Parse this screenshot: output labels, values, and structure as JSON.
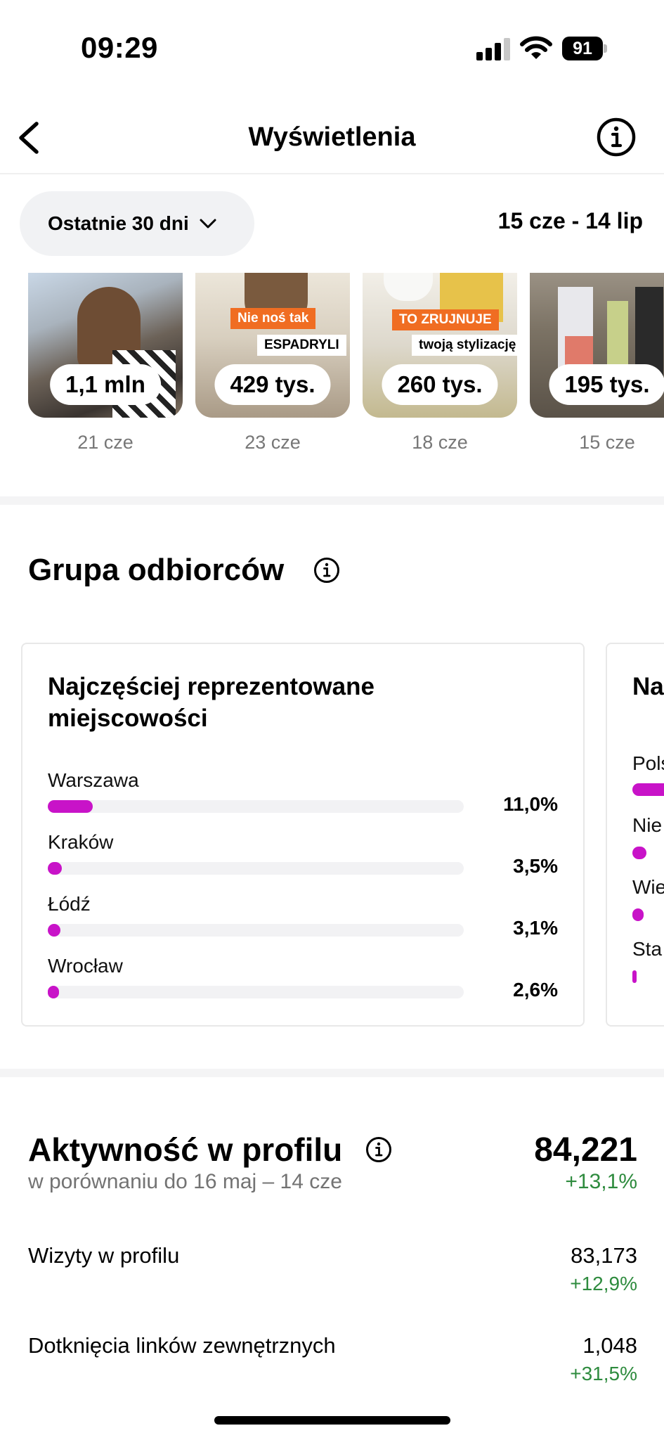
{
  "status_bar": {
    "time": "09:29",
    "battery": "91"
  },
  "header": {
    "title": "Wyświetlenia"
  },
  "filter": {
    "period_label": "Ostatnie 30 dni",
    "date_range": "15 cze - 14 lip"
  },
  "top_content": [
    {
      "views": "1,1 mln",
      "date": "21 cze"
    },
    {
      "views": "429 tys.",
      "date": "23 cze",
      "overlay_1": "Nie noś tak",
      "overlay_2": "ESPADRYLI"
    },
    {
      "views": "260 tys.",
      "date": "18 cze",
      "overlay_1": "TO ZRUJNUJE",
      "overlay_2": "twoją stylizację"
    },
    {
      "views": "195 tys.",
      "date": "15 cze"
    }
  ],
  "audience": {
    "title": "Grupa odbiorców",
    "cities_card": {
      "title_line1": "Najczęściej reprezentowane",
      "title_line2": "miejscowości",
      "rows": [
        {
          "label": "Warszawa",
          "value": "11,0%",
          "pct": 11.0
        },
        {
          "label": "Kraków",
          "value": "3,5%",
          "pct": 3.5
        },
        {
          "label": "Łódź",
          "value": "3,1%",
          "pct": 3.1
        },
        {
          "label": "Wrocław",
          "value": "2,6%",
          "pct": 2.6
        }
      ]
    },
    "next_card": {
      "title": "Na",
      "rows": [
        {
          "label": "Pols"
        },
        {
          "label": "Nie"
        },
        {
          "label": "Wie"
        },
        {
          "label": "Sta"
        }
      ]
    }
  },
  "activity": {
    "title": "Aktywność w profilu",
    "subtitle": "w porównaniu do 16 maj – 14 cze",
    "total": "84,221",
    "total_change": "+13,1%",
    "rows": [
      {
        "label": "Wizyty w profilu",
        "value": "83,173",
        "change": "+12,9%"
      },
      {
        "label": "Dotknięcia linków zewnętrznych",
        "value": "1,048",
        "change": "+31,5%"
      }
    ]
  },
  "colors": {
    "accent_bar": "#c813c8",
    "positive": "#2e8b3e"
  }
}
